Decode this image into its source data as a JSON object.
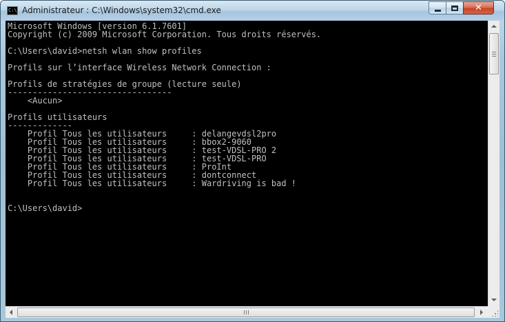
{
  "window": {
    "title": "Administrateur : C:\\Windows\\system32\\cmd.exe",
    "icon_label": "C:\\",
    "controls": {
      "minimize": "minimize-icon",
      "maximize": "maximize-icon",
      "close": "✕"
    }
  },
  "console": {
    "lines": [
      "Microsoft Windows [version 6.1.7601]",
      "Copyright (c) 2009 Microsoft Corporation. Tous droits réservés.",
      "",
      "C:\\Users\\david>netsh wlan show profiles",
      "",
      "Profils sur l’interface Wireless Network Connection :",
      "",
      "Profils de stratégies de groupe (lecture seule)",
      "---------------------------------",
      "    <Aucun>",
      "",
      "Profils utilisateurs",
      "-------------",
      "    Profil Tous les utilisateurs     : delangevdsl2pro",
      "    Profil Tous les utilisateurs     : bbox2-9060",
      "    Profil Tous les utilisateurs     : test-VDSL-PRO 2",
      "    Profil Tous les utilisateurs     : test-VDSL-PRO",
      "    Profil Tous les utilisateurs     : ProInt",
      "    Profil Tous les utilisateurs     : dontconnect",
      "    Profil Tous les utilisateurs     : Wardriving is bad !",
      "",
      "",
      "C:\\Users\\david>"
    ],
    "colors": {
      "background": "#000000",
      "foreground": "#c0c0c0"
    }
  }
}
